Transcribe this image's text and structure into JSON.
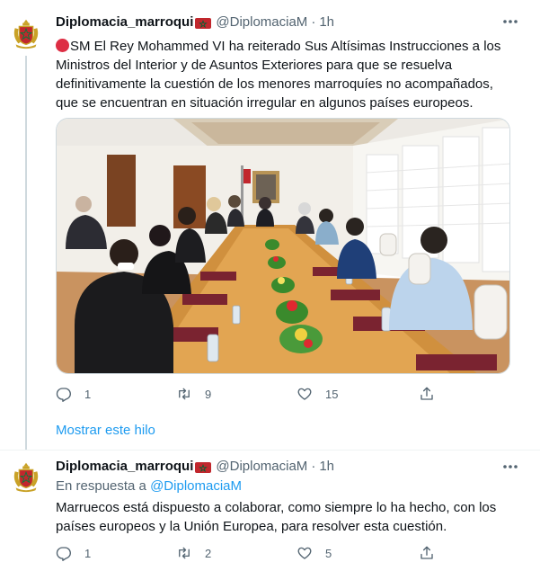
{
  "tweets": [
    {
      "author": {
        "name": "Diplomacia_marroqui",
        "handle": "@DiplomaciaM",
        "flag": "morocco-flag"
      },
      "separator": "·",
      "time": "1h",
      "emoji": "red-circle",
      "text": "SM El Rey Mohammed VI ha reiterado Sus Altísimas Instrucciones a los Ministros del Interior y de Asuntos Exteriores para que se resuelva definitivamente la cuestión de los menores marroquíes no acompañados, que se encuentran en situación irregular en algunos países europeos.",
      "actions": {
        "replies": "1",
        "retweets": "9",
        "likes": "15"
      }
    },
    {
      "author": {
        "name": "Diplomacia_marroqui",
        "handle": "@DiplomaciaM",
        "flag": "morocco-flag"
      },
      "separator": "·",
      "time": "1h",
      "reply_prefix": "En respuesta a",
      "reply_to": "@DiplomaciaM",
      "text": "Marruecos está dispuesto a colaborar, como siempre lo ha hecho, con los países europeos y la Unión Europea, para resolver esta cuestión.",
      "actions": {
        "replies": "1",
        "retweets": "2",
        "likes": "5"
      }
    }
  ],
  "show_thread": "Mostrar este hilo",
  "colors": {
    "accent": "#1d9bf0",
    "muted": "#536471",
    "text": "#0f1419",
    "divider": "#eff3f4",
    "flag_red": "#c1272d",
    "flag_green": "#006233"
  }
}
